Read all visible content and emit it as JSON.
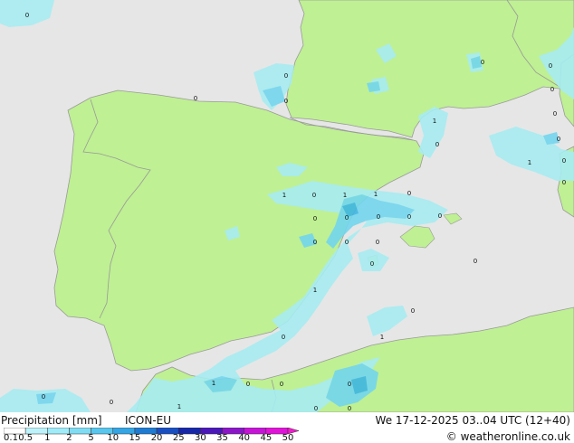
{
  "map": {
    "colors": {
      "sea": "#e6e6e6",
      "land": "#bff093",
      "border": "#999999",
      "rain_light": "#a7ecf2",
      "rain_medium": "#73d6ee",
      "rain_heavy": "#3fb6e2"
    },
    "point_labels": [
      "0",
      "0",
      "0",
      "0",
      "0",
      "0",
      "1",
      "0",
      "0",
      "0",
      "0",
      "1",
      "0",
      "1",
      "1",
      "1",
      "0",
      "0",
      "0",
      "0",
      "0",
      "0",
      "0",
      "0",
      "0",
      "1",
      "0",
      "1",
      "0",
      "0",
      "1",
      "0",
      "0",
      "0",
      "0",
      "0",
      "0",
      "1",
      "0",
      "0",
      "0",
      "0"
    ]
  },
  "footer": {
    "title": "Precipitation [mm]",
    "model": "ICON-EU",
    "datetime": "We 17-12-2025 03..04 UTC (12+40)",
    "copyright": "© weatheronline.co.uk"
  },
  "legend": {
    "tick_labels": [
      "0.1",
      "0.5",
      "1",
      "2",
      "5",
      "10",
      "15",
      "20",
      "25",
      "30",
      "35",
      "40",
      "45",
      "50"
    ],
    "colors": [
      "#ffffff",
      "#bdf2fa",
      "#a0ebf8",
      "#7fdcf3",
      "#58c6ed",
      "#35a5e3",
      "#1f7bd1",
      "#1a4fc1",
      "#1627a8",
      "#4a17b8",
      "#8a16c8",
      "#c514d6",
      "#e014d8",
      "#f21bcd"
    ]
  }
}
